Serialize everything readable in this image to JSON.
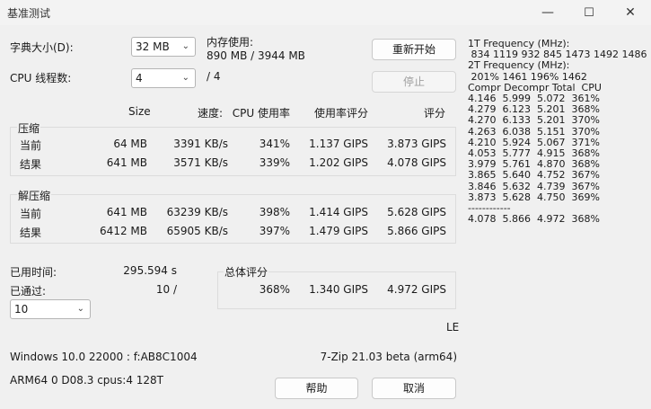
{
  "window": {
    "title": "基准测试",
    "minimize": "—",
    "maximize": "☐",
    "close": "✕"
  },
  "labels": {
    "dict_size": "字典大小(D):",
    "threads": "CPU 线程数:",
    "mem_usage": "内存使用:",
    "mem_value": "890 MB / 3944 MB",
    "threads_total": "/ 4",
    "compress": "压缩",
    "decompress": "解压缩",
    "current": "当前",
    "result": "结果",
    "elapsed": "已用时间:",
    "passed": "已通过:",
    "total_rating": "总体评分",
    "le": "LE",
    "os": "Windows 10.0 22000 : f:AB8C1004",
    "cpu": "ARM64 0 D08.3 cpus:4 128T",
    "version": "7-Zip 21.03 beta (arm64)"
  },
  "controls": {
    "dict_value": "32 MB",
    "threads_value": "4",
    "passes_value": "10",
    "restart": "重新开始",
    "stop": "停止",
    "help": "帮助",
    "cancel": "取消"
  },
  "headers": {
    "size": "Size",
    "speed": "速度:",
    "cpu_usage": "CPU 使用率",
    "usage_rating": "使用率评分",
    "rating": "评分"
  },
  "compress_rows": [
    {
      "label": "当前",
      "size": "64 MB",
      "speed": "3391 KB/s",
      "cpu": "341%",
      "usage_rating": "1.137 GIPS",
      "rating": "3.873 GIPS"
    },
    {
      "label": "结果",
      "size": "641 MB",
      "speed": "3571 KB/s",
      "cpu": "339%",
      "usage_rating": "1.202 GIPS",
      "rating": "4.078 GIPS"
    }
  ],
  "decompress_rows": [
    {
      "label": "当前",
      "size": "641 MB",
      "speed": "63239 KB/s",
      "cpu": "398%",
      "usage_rating": "1.414 GIPS",
      "rating": "5.628 GIPS"
    },
    {
      "label": "结果",
      "size": "6412 MB",
      "speed": "65905 KB/s",
      "cpu": "397%",
      "usage_rating": "1.479 GIPS",
      "rating": "5.866 GIPS"
    }
  ],
  "elapsed_value": "295.594 s",
  "passed_value": "10 /",
  "total": {
    "cpu": "368%",
    "usage_rating": "1.340 GIPS",
    "rating": "4.972 GIPS"
  },
  "log": [
    "1T Frequency (MHz):",
    " 834 1119 932 845 1473 1492 1486",
    "2T Frequency (MHz):",
    " 201% 1461 196% 1462",
    "Compr Decompr Total  CPU",
    "4.146  5.999  5.072  361%",
    "4.279  6.123  5.201  368%",
    "4.270  6.133  5.201  370%",
    "4.263  6.038  5.151  370%",
    "4.210  5.924  5.067  371%",
    "4.053  5.777  4.915  368%",
    "3.979  5.761  4.870  368%",
    "3.865  5.640  4.752  367%",
    "3.846  5.632  4.739  367%",
    "3.873  5.628  4.750  369%",
    "------------",
    "4.078  5.866  4.972  368%"
  ]
}
